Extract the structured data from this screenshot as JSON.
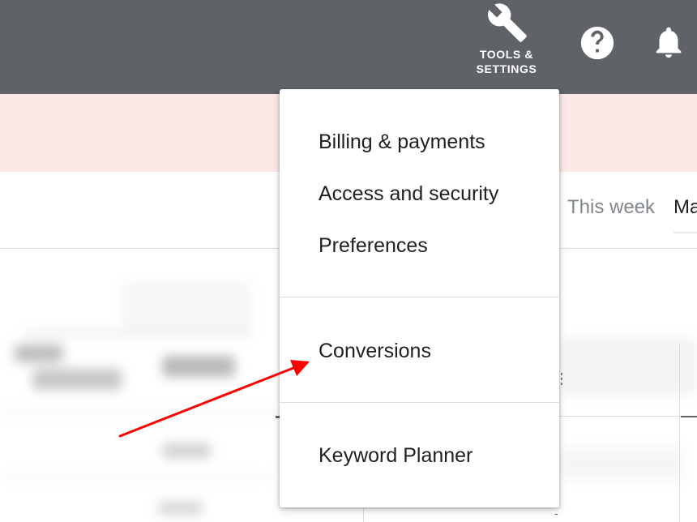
{
  "header": {
    "tools_label_line1": "TOOLS &",
    "tools_label_line2": "SETTINGS",
    "tools_icon": "wrench-icon",
    "help_icon": "help-circle-icon",
    "notifications_icon": "bell-icon"
  },
  "date_range": {
    "options": [
      "This week",
      "Ma"
    ]
  },
  "menu": {
    "items": [
      "Billing & payments",
      "Access and security",
      "Preferences",
      "Conversions",
      "Keyword Planner"
    ]
  },
  "annotation": {
    "type": "arrow",
    "color": "#ff0000",
    "points_to": "Conversions"
  },
  "colors": {
    "topbar": "#5f6368",
    "banner": "#fce8e6",
    "menu_text": "#202124",
    "arrow": "#ff0000"
  },
  "table_fragments": {
    "kebab": "⋮",
    "dashes": [
      "-",
      "-"
    ]
  }
}
